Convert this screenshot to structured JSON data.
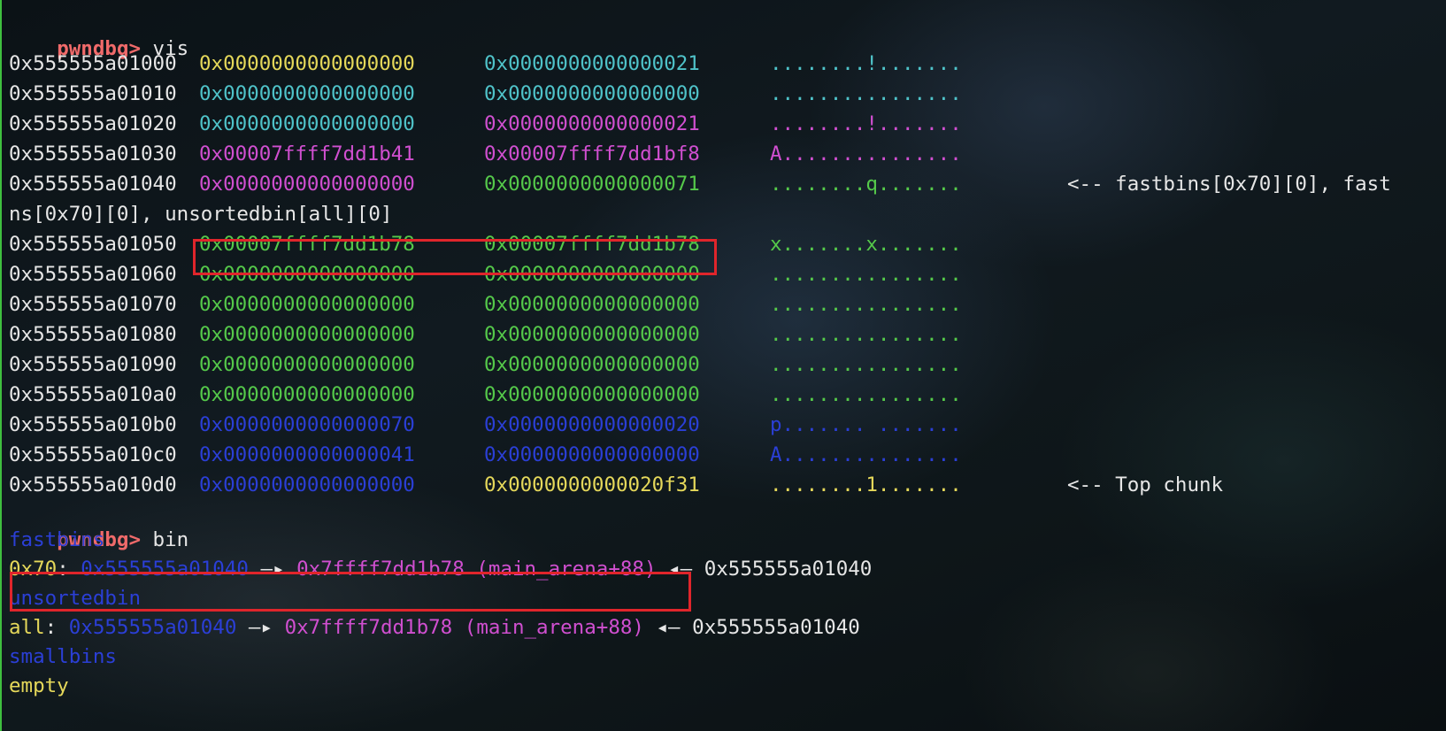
{
  "colors": {
    "prompt": "#f06a6a",
    "yellow": "#e5d85a",
    "cyan": "#4fc3c9",
    "magenta": "#d04fd0",
    "green": "#55c94a",
    "blue": "#2b3fd6",
    "white": "#e6e6e6",
    "highlight": "#e0252b"
  },
  "prompt1": {
    "prompt": "pwndbg>",
    "cmd": " vis"
  },
  "rows": [
    {
      "addr": "0x555555a01000",
      "v1": "0x0000000000000000",
      "v2": "0x0000000000000021",
      "ascii": "........!.......",
      "c1": "yellow",
      "c2": "cyan",
      "c3": "cyan",
      "note": ""
    },
    {
      "addr": "0x555555a01010",
      "v1": "0x0000000000000000",
      "v2": "0x0000000000000000",
      "ascii": "................",
      "c1": "cyan",
      "c2": "cyan",
      "c3": "cyan",
      "note": ""
    },
    {
      "addr": "0x555555a01020",
      "v1": "0x0000000000000000",
      "v2": "0x0000000000000021",
      "ascii": "........!.......",
      "c1": "cyan",
      "c2": "magenta",
      "c3": "magenta",
      "note": ""
    },
    {
      "addr": "0x555555a01030",
      "v1": "0x00007ffff7dd1b41",
      "v2": "0x00007ffff7dd1bf8",
      "ascii": "A...............",
      "c1": "magenta",
      "c2": "magenta",
      "c3": "magenta",
      "note": ""
    },
    {
      "addr": "0x555555a01040",
      "v1": "0x0000000000000000",
      "v2": "0x0000000000000071",
      "ascii": "........q.......",
      "c1": "magenta",
      "c2": "green",
      "c3": "green",
      "note": "<-- fastbins[0x70][0], fast"
    },
    {
      "addr": "",
      "v1": "",
      "v2": "",
      "ascii": "",
      "c1": "white",
      "c2": "white",
      "c3": "white",
      "note": "",
      "wrap": "ns[0x70][0], unsortedbin[all][0]"
    },
    {
      "addr": "0x555555a01050",
      "v1": "0x00007ffff7dd1b78",
      "v2": "0x00007ffff7dd1b78",
      "ascii": "x.......x.......",
      "c1": "green",
      "c2": "green",
      "c3": "green",
      "note": ""
    },
    {
      "addr": "0x555555a01060",
      "v1": "0x0000000000000000",
      "v2": "0x0000000000000000",
      "ascii": "................",
      "c1": "green",
      "c2": "green",
      "c3": "green",
      "note": ""
    },
    {
      "addr": "0x555555a01070",
      "v1": "0x0000000000000000",
      "v2": "0x0000000000000000",
      "ascii": "................",
      "c1": "green",
      "c2": "green",
      "c3": "green",
      "note": ""
    },
    {
      "addr": "0x555555a01080",
      "v1": "0x0000000000000000",
      "v2": "0x0000000000000000",
      "ascii": "................",
      "c1": "green",
      "c2": "green",
      "c3": "green",
      "note": ""
    },
    {
      "addr": "0x555555a01090",
      "v1": "0x0000000000000000",
      "v2": "0x0000000000000000",
      "ascii": "................",
      "c1": "green",
      "c2": "green",
      "c3": "green",
      "note": ""
    },
    {
      "addr": "0x555555a010a0",
      "v1": "0x0000000000000000",
      "v2": "0x0000000000000000",
      "ascii": "................",
      "c1": "green",
      "c2": "green",
      "c3": "green",
      "note": ""
    },
    {
      "addr": "0x555555a010b0",
      "v1": "0x0000000000000070",
      "v2": "0x0000000000000020",
      "ascii": "p....... .......",
      "c1": "blue",
      "c2": "blue",
      "c3": "blue",
      "note": ""
    },
    {
      "addr": "0x555555a010c0",
      "v1": "0x0000000000000041",
      "v2": "0x0000000000000000",
      "ascii": "A...............",
      "c1": "blue",
      "c2": "blue",
      "c3": "blue",
      "note": ""
    },
    {
      "addr": "0x555555a010d0",
      "v1": "0x0000000000000000",
      "v2": "0x0000000000020f31",
      "ascii": "........1.......",
      "c1": "blue",
      "c2": "yellow",
      "c3": "yellow",
      "note": "<-- Top chunk"
    }
  ],
  "prompt2": {
    "prompt": "pwndbg>",
    "cmd": " bin"
  },
  "bins": {
    "fastbins_label": "fastbins",
    "fast_entry": {
      "size": "0x70",
      "sep": ": ",
      "chunk": "0x555555a01040",
      "arrow": " —▸ ",
      "target": "0x7ffff7dd1b78 (main_arena+88)",
      "back": " ◂— 0x555555a01040"
    },
    "unsorted_label": "unsortedbin",
    "unsorted_entry": {
      "size": "all",
      "sep": ": ",
      "chunk": "0x555555a01040",
      "arrow": " —▸ ",
      "target": "0x7ffff7dd1b78 (main_arena+88)",
      "back": " ◂— 0x555555a01040"
    },
    "small_label": "smallbins",
    "small_value": "empty"
  }
}
